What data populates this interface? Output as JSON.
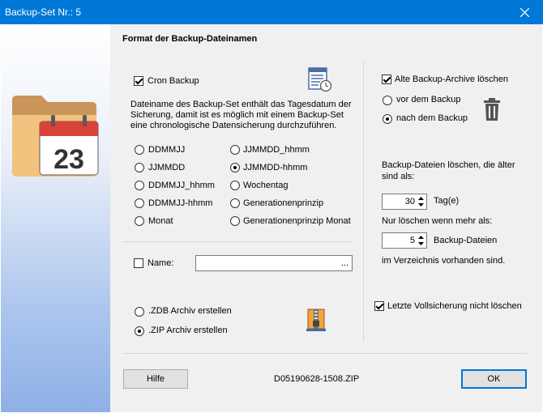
{
  "window": {
    "title": "Backup-Set Nr.: 5"
  },
  "section_title": "Format der Backup-Dateinamen",
  "cron_backup": {
    "label": "Cron Backup",
    "checked": true
  },
  "description": "Dateiname des Backup-Set enthält das Tagesdatum der Sicherung, damit ist es möglich mit einem Backup-Set eine chronologische Datensicherung durchzuführen.",
  "formats_left": [
    {
      "label": "DDMMJJ",
      "selected": false
    },
    {
      "label": "JJMMDD",
      "selected": false
    },
    {
      "label": "DDMMJJ_hhmm",
      "selected": false
    },
    {
      "label": "DDMMJJ-hhmm",
      "selected": false
    },
    {
      "label": "Monat",
      "selected": false
    }
  ],
  "formats_right": [
    {
      "label": "JJMMDD_hhmm",
      "selected": false
    },
    {
      "label": "JJMMDD-hhmm",
      "selected": true
    },
    {
      "label": "Wochentag",
      "selected": false
    },
    {
      "label": "Generationenprinzip",
      "selected": false
    },
    {
      "label": "Generationenprinzip Monat",
      "selected": false
    }
  ],
  "name": {
    "label": "Name:",
    "checked": false,
    "value": "",
    "browse_label": "..."
  },
  "archive": {
    "zdb_label": ".ZDB Archiv erstellen",
    "zip_label": ".ZIP Archiv erstellen",
    "selected": "zip"
  },
  "delete_old": {
    "label": "Alte Backup-Archive löschen",
    "checked": true
  },
  "delete_timing": {
    "before_label": "vor dem Backup",
    "after_label": "nach dem Backup",
    "selected": "after"
  },
  "older_than_label": "Backup-Dateien löschen, die älter sind als:",
  "days": {
    "value": "30",
    "unit": "Tag(e)"
  },
  "only_if_more_label": "Nur löschen wenn mehr als:",
  "files": {
    "value": "5",
    "unit": "Backup-Dateien"
  },
  "in_directory_label": "im Verzeichnis vorhanden sind.",
  "keep_last_full": {
    "label": "Letzte Vollsicherung nicht löschen",
    "checked": true
  },
  "footer": {
    "help_label": "Hilfe",
    "filename_preview": "D05190628-1508.ZIP",
    "ok_label": "OK"
  },
  "icons": {
    "calendar_number": "23",
    "app_icon": "folder-calendar-icon",
    "schedule_icon": "schedule-list-icon",
    "trash_icon": "trash-icon",
    "archive_icon": "archive-icon"
  },
  "colors": {
    "titlebar": "#0078d7",
    "accent": "#0078d7"
  }
}
